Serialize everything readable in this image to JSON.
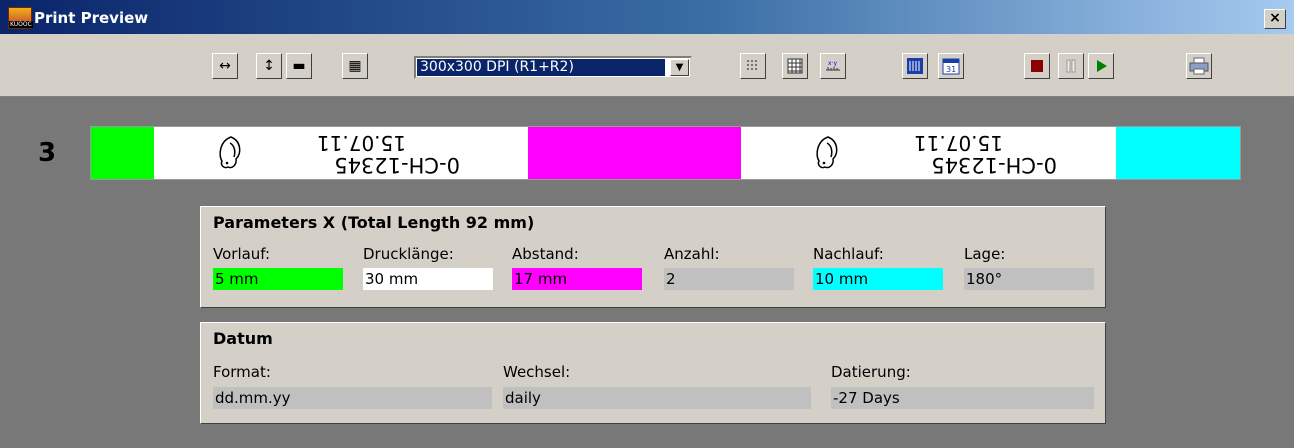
{
  "window": {
    "title": "Print Preview",
    "close": "×",
    "icon_text": "KUOOC"
  },
  "toolbar": {
    "buttons_left": [
      {
        "name": "fit-width-button",
        "glyph": "↔"
      },
      {
        "name": "fit-height-button",
        "glyph": "↕"
      },
      {
        "name": "zoom-out-button",
        "glyph": "▬"
      },
      {
        "name": "zoom-fit-button",
        "glyph": "▦"
      }
    ],
    "dpi_select": "300x300 DPI (R1+R2)",
    "colors": {
      "stop": "#8b0000",
      "play": "#008000"
    }
  },
  "preview": {
    "row_number": "3",
    "imprint_line1": "15.07.11",
    "imprint_line2": "0-CH-12345",
    "colors": {
      "vorlauf": "#00ff00",
      "abstand": "#ff00ff",
      "nachlauf": "#00ffff"
    }
  },
  "params": {
    "title": "Parameters X  (Total Length 92 mm)",
    "vorlauf": {
      "label": "Vorlauf:",
      "value": "5 mm"
    },
    "drucklaenge": {
      "label": "Drucklänge:",
      "value": "30 mm"
    },
    "abstand": {
      "label": "Abstand:",
      "value": "17 mm"
    },
    "anzahl": {
      "label": "Anzahl:",
      "value": "2"
    },
    "nachlauf": {
      "label": "Nachlauf:",
      "value": "10 mm"
    },
    "lage": {
      "label": "Lage:",
      "value": "180°"
    }
  },
  "datum": {
    "title": "Datum",
    "format": {
      "label": "Format:",
      "value": "dd.mm.yy"
    },
    "wechsel": {
      "label": "Wechsel:",
      "value": "daily"
    },
    "datierung": {
      "label": "Datierung:",
      "value": "-27 Days"
    }
  }
}
